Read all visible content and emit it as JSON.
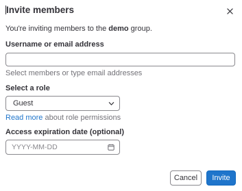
{
  "modal": {
    "title": "Invite members",
    "close_icon": "close-icon"
  },
  "intro": {
    "prefix": "You're inviting members to the ",
    "group_name": "demo",
    "suffix": " group."
  },
  "username": {
    "label": "Username or email address",
    "value": "",
    "help": "Select members or type email addresses"
  },
  "role": {
    "label": "Select a role",
    "selected": "Guest",
    "chevron_icon": "chevron-down-icon",
    "read_more_link": "Read more",
    "read_more_suffix": " about role permissions"
  },
  "expiration": {
    "label": "Access expiration date (optional)",
    "placeholder": "YYYY-MM-DD",
    "calendar_icon": "calendar-icon"
  },
  "actions": {
    "cancel_label": "Cancel",
    "invite_label": "Invite"
  },
  "colors": {
    "primary": "#1f75cb",
    "border": "#89888d",
    "text": "#333238",
    "muted": "#737278"
  }
}
